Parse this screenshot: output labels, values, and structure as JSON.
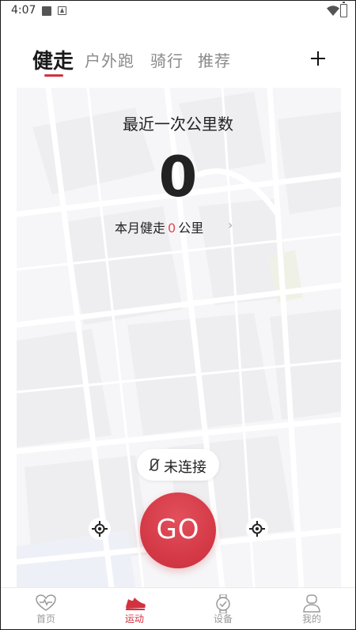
{
  "status_bar": {
    "time": "4:07"
  },
  "tabs": [
    {
      "label": "健走",
      "active": true
    },
    {
      "label": "户外跑",
      "active": false
    },
    {
      "label": "骑行",
      "active": false
    },
    {
      "label": "推荐",
      "active": false
    }
  ],
  "add_icon": "plus-icon",
  "summary": {
    "title": "最近一次公里数",
    "value": "0",
    "monthly_prefix": "本月健走",
    "monthly_value": "0",
    "monthly_unit": "公里",
    "chevron": "›"
  },
  "device": {
    "icon": "unlink-icon",
    "label": "未连接"
  },
  "go": {
    "label": "GO"
  },
  "bottom_nav": [
    {
      "label": "首页",
      "icon": "heart-pulse-icon",
      "active": false
    },
    {
      "label": "运动",
      "icon": "shoe-icon",
      "active": true
    },
    {
      "label": "设备",
      "icon": "watch-icon",
      "active": false
    },
    {
      "label": "我的",
      "icon": "profile-icon",
      "active": false
    }
  ],
  "colors": {
    "accent": "#d2323f",
    "go_button": "#d53a47",
    "map_bg": "#f6f6f8"
  }
}
